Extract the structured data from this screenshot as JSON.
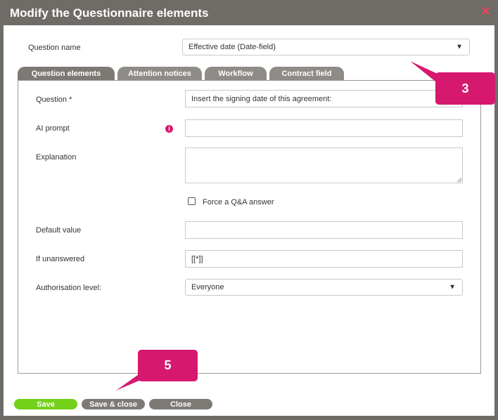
{
  "dialog": {
    "title": "Modify the Questionnaire elements"
  },
  "question_name": {
    "label": "Question name",
    "value": "Effective date (Date-field)"
  },
  "tabs": [
    {
      "label": "Question elements",
      "active": true
    },
    {
      "label": "Attention notices",
      "active": false
    },
    {
      "label": "Workflow",
      "active": false
    },
    {
      "label": "Contract field",
      "active": false
    }
  ],
  "form": {
    "question": {
      "label": "Question *",
      "value": "Insert the signing date of this agreement:"
    },
    "ai_prompt": {
      "label": "AI prompt",
      "value": ""
    },
    "explanation": {
      "label": "Explanation",
      "value": ""
    },
    "force_qa": {
      "label": "Force a Q&A answer",
      "checked": false
    },
    "default_value": {
      "label": "Default value",
      "value": ""
    },
    "if_unanswered": {
      "label": "If unanswered",
      "value": "[[*]]"
    },
    "authorisation": {
      "label": "Authorisation level:",
      "value": "Everyone"
    }
  },
  "callouts": {
    "a": "3",
    "b": "5"
  },
  "buttons": {
    "save": "Save",
    "save_close": "Save & close",
    "close": "Close"
  },
  "colors": {
    "accent": "#d6186f",
    "save": "#73d11a",
    "titlebar": "#6f6c68"
  }
}
